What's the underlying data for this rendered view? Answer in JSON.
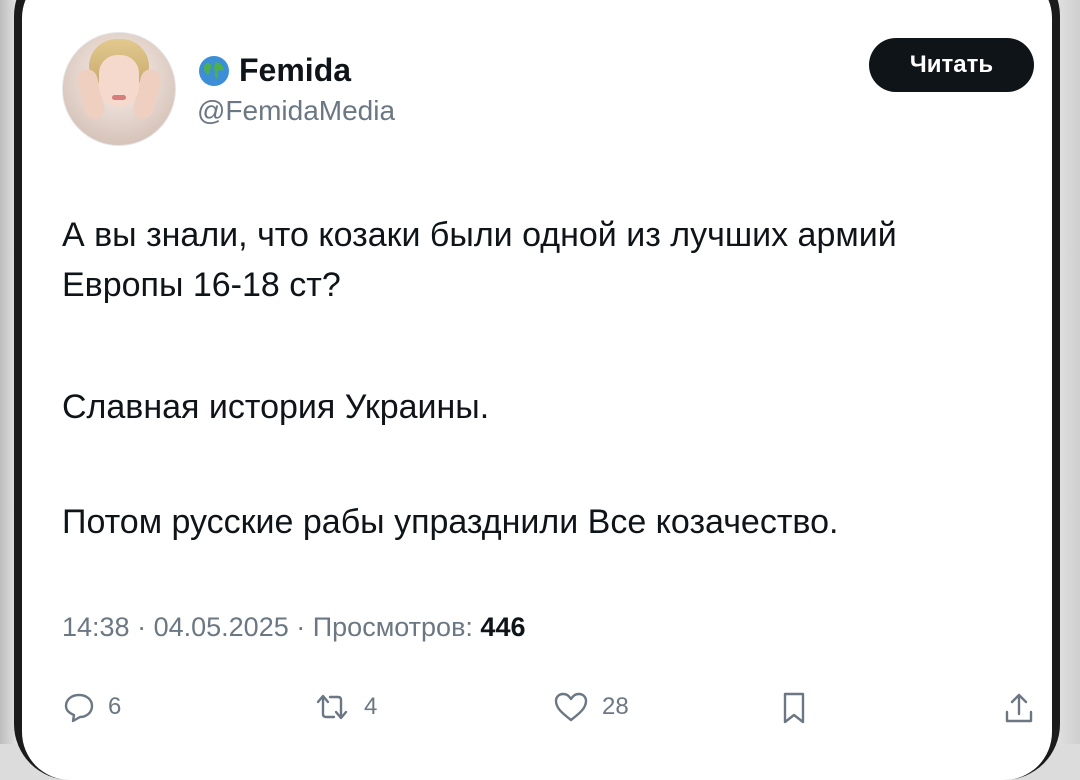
{
  "post": {
    "author": {
      "display_name": "Femida",
      "handle": "@FemidaMedia",
      "badge_icon": "globe-icon"
    },
    "read_button_label": "Читать",
    "paragraphs": [
      "А вы знали, что козаки были одной из лучших армий Европы 16-18 ст?",
      "Славная история Украины.",
      "Потом русские рабы упразднили Все козачество."
    ],
    "time": "14:38",
    "date": "04.05.2025",
    "views_label": "Просмотров:",
    "views_count": "446",
    "separator": "·",
    "actions": {
      "replies": "6",
      "reposts": "4",
      "likes": "28"
    }
  },
  "colors": {
    "text": "#0f1419",
    "secondary": "#6b7782",
    "button_bg": "#0f1419",
    "button_text": "#ffffff"
  }
}
